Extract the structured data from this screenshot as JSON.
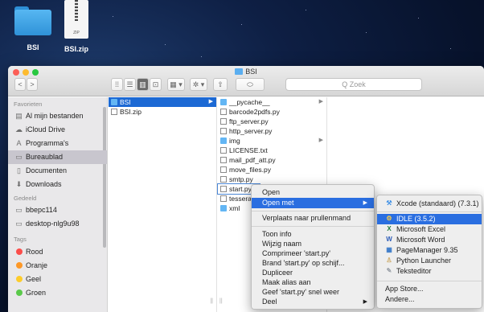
{
  "desktop": {
    "items": [
      {
        "label": "BSI"
      },
      {
        "label": "BSI.zip",
        "badge": "ZIP"
      }
    ]
  },
  "window": {
    "title": "BSI",
    "search_placeholder": "Q Zoek",
    "toolbar": {
      "back": "<",
      "forward": ">",
      "view_icons": "⁞⁞",
      "view_list": "☰",
      "view_columns": "▥",
      "view_gallery": "⊡",
      "group": "▦ ▾",
      "action": "✲ ▾",
      "share": "⇧",
      "tag": "⬭"
    }
  },
  "sidebar": {
    "sections": [
      {
        "title": "Favorieten",
        "items": [
          {
            "label": "Al mijn bestanden",
            "icon": "all-files-icon",
            "glyph": "▤"
          },
          {
            "label": "iCloud Drive",
            "icon": "cloud-icon",
            "glyph": "☁"
          },
          {
            "label": "Programma's",
            "icon": "applications-icon",
            "glyph": "A"
          },
          {
            "label": "Bureaublad",
            "icon": "desktop-icon",
            "glyph": "▭",
            "selected": true
          },
          {
            "label": "Documenten",
            "icon": "documents-icon",
            "glyph": "▯"
          },
          {
            "label": "Downloads",
            "icon": "downloads-icon",
            "glyph": "⬇"
          }
        ]
      },
      {
        "title": "Gedeeld",
        "items": [
          {
            "label": "bbepc114",
            "icon": "computer-icon",
            "glyph": "▭"
          },
          {
            "label": "desktop-nlg9u98",
            "icon": "computer-icon",
            "glyph": "▭"
          }
        ]
      },
      {
        "title": "Tags",
        "items": [
          {
            "label": "Rood",
            "color": "#fb4d4a"
          },
          {
            "label": "Oranje",
            "color": "#fd9827"
          },
          {
            "label": "Geel",
            "color": "#fdcc2b"
          },
          {
            "label": "Groen",
            "color": "#5ac94a"
          }
        ]
      }
    ]
  },
  "columns": {
    "col1": [
      {
        "name": "BSI",
        "type": "folder",
        "selected": true,
        "has_children": true
      },
      {
        "name": "BSI.zip",
        "type": "file"
      }
    ],
    "col2": [
      {
        "name": "__pycache__",
        "type": "folder",
        "has_children": true
      },
      {
        "name": "barcode2pdfs.py",
        "type": "file"
      },
      {
        "name": "ftp_server.py",
        "type": "file"
      },
      {
        "name": "http_server.py",
        "type": "file"
      },
      {
        "name": "img",
        "type": "folder",
        "has_children": true
      },
      {
        "name": "LICENSE.txt",
        "type": "file"
      },
      {
        "name": "mail_pdf_att.py",
        "type": "file"
      },
      {
        "name": "move_files.py",
        "type": "file"
      },
      {
        "name": "smtp.py",
        "type": "file"
      },
      {
        "name": "start.py",
        "type": "file",
        "outlined": true
      },
      {
        "name": "tesseract",
        "type": "file"
      },
      {
        "name": "xml",
        "type": "folder"
      }
    ]
  },
  "context_menu": {
    "items": [
      {
        "label": "Open"
      },
      {
        "label": "Open met",
        "submenu": true,
        "highlighted": true
      },
      {
        "separator": true
      },
      {
        "label": "Verplaats naar prullenmand"
      },
      {
        "separator": true
      },
      {
        "label": "Toon info"
      },
      {
        "label": "Wijzig naam"
      },
      {
        "label": "Comprimeer 'start.py'"
      },
      {
        "label": "Brand 'start.py' op schijf..."
      },
      {
        "label": "Dupliceer"
      },
      {
        "label": "Maak alias aan"
      },
      {
        "label": "Geef 'start.py' snel weer"
      },
      {
        "label": "Deel",
        "submenu": true
      }
    ]
  },
  "submenu": {
    "items": [
      {
        "label": "Xcode (standaard) (7.3.1)",
        "icon": "xcode-icon",
        "glyph": "⚒",
        "color": "#3a8ee6"
      },
      {
        "separator": true
      },
      {
        "label": "IDLE (3.5.2)",
        "icon": "idle-icon",
        "glyph": "⚙",
        "color": "#f2c94c",
        "highlighted": true
      },
      {
        "label": "Microsoft Excel",
        "icon": "excel-icon",
        "glyph": "X",
        "color": "#1f7a3e"
      },
      {
        "label": "Microsoft Word",
        "icon": "word-icon",
        "glyph": "W",
        "color": "#2b5bb8"
      },
      {
        "label": "PageManager 9.35",
        "icon": "pagemanager-icon",
        "glyph": "▦",
        "color": "#3778c8"
      },
      {
        "label": "Python Launcher",
        "icon": "python-launcher-icon",
        "glyph": "♙",
        "color": "#c9a35a"
      },
      {
        "label": "Teksteditor",
        "icon": "texteditor-icon",
        "glyph": "✎",
        "color": "#9aa0a8"
      },
      {
        "separator": true
      },
      {
        "label": "App Store..."
      },
      {
        "label": "Andere..."
      }
    ]
  }
}
